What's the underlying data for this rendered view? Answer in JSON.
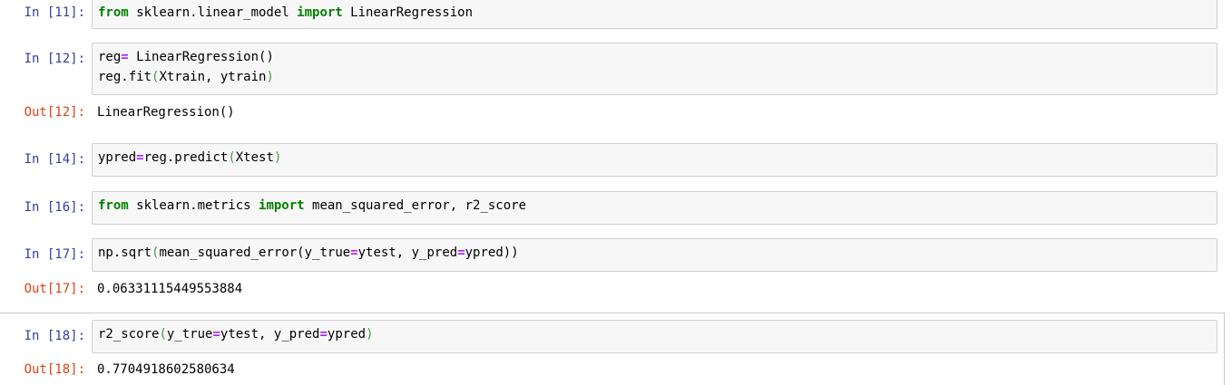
{
  "cells": [
    {
      "prompt": "In [11]:",
      "lines": [
        [
          {
            "t": "from",
            "c": "kw"
          },
          {
            "t": " sklearn.linear_model ",
            "c": ""
          },
          {
            "t": "import",
            "c": "kw"
          },
          {
            "t": " LinearRegression",
            "c": ""
          }
        ]
      ]
    },
    {
      "prompt": "In [12]:",
      "lines": [
        [
          {
            "t": "reg",
            "c": ""
          },
          {
            "t": "=",
            "c": "op"
          },
          {
            "t": " LinearRegression()",
            "c": ""
          }
        ],
        [
          {
            "t": "reg.fit",
            "c": ""
          },
          {
            "t": "(",
            "c": "par"
          },
          {
            "t": "Xtrain, ytrain",
            "c": ""
          },
          {
            "t": ")",
            "c": "par"
          }
        ]
      ],
      "out_prompt": "Out[12]:",
      "output": "LinearRegression()"
    },
    {
      "prompt": "In [14]:",
      "lines": [
        [
          {
            "t": "ypred",
            "c": ""
          },
          {
            "t": "=",
            "c": "op"
          },
          {
            "t": "reg.predict",
            "c": ""
          },
          {
            "t": "(",
            "c": "par"
          },
          {
            "t": "Xtest",
            "c": ""
          },
          {
            "t": ")",
            "c": "par"
          }
        ]
      ]
    },
    {
      "prompt": "In [16]:",
      "lines": [
        [
          {
            "t": "from",
            "c": "kw"
          },
          {
            "t": " sklearn.metrics ",
            "c": ""
          },
          {
            "t": "import",
            "c": "kw"
          },
          {
            "t": " mean_squared_error, r2_score",
            "c": ""
          }
        ]
      ]
    },
    {
      "prompt": "In [17]:",
      "lines": [
        [
          {
            "t": "np.sqrt",
            "c": ""
          },
          {
            "t": "(",
            "c": "par"
          },
          {
            "t": "mean_squared_error(y_true",
            "c": ""
          },
          {
            "t": "=",
            "c": "op"
          },
          {
            "t": "ytest, y_pred",
            "c": ""
          },
          {
            "t": "=",
            "c": "op"
          },
          {
            "t": "ypred))",
            "c": ""
          }
        ]
      ],
      "out_prompt": "Out[17]:",
      "output": "0.06331115449553884"
    },
    {
      "prompt": "In [18]:",
      "lines": [
        [
          {
            "t": "r2_score",
            "c": ""
          },
          {
            "t": "(",
            "c": "par"
          },
          {
            "t": "y_true",
            "c": ""
          },
          {
            "t": "=",
            "c": "op"
          },
          {
            "t": "ytest, y_pred",
            "c": ""
          },
          {
            "t": "=",
            "c": "op"
          },
          {
            "t": "ypred",
            "c": ""
          },
          {
            "t": ")",
            "c": "par"
          }
        ]
      ],
      "out_prompt": "Out[18]:",
      "output": "0.7704918602580634"
    }
  ]
}
